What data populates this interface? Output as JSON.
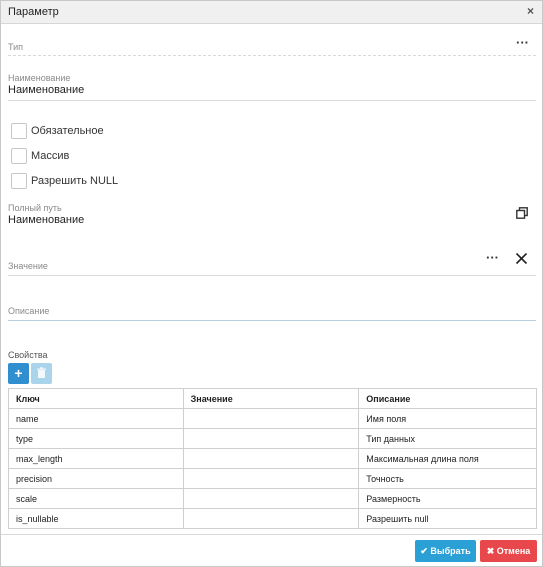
{
  "dialog": {
    "title": "Параметр",
    "close_glyph": "×"
  },
  "type_field": {
    "label": "Тип",
    "value": "",
    "action_glyph": "···"
  },
  "name_field": {
    "label": "Наименование",
    "value": "Наименование"
  },
  "checkboxes": [
    {
      "label": "Обязательное",
      "checked": false
    },
    {
      "label": "Массив",
      "checked": false
    },
    {
      "label": "Разрешить NULL",
      "checked": false
    }
  ],
  "full_path_field": {
    "label": "Полный путь",
    "value": "Наименование",
    "copy_icon": "copy-icon"
  },
  "value_field": {
    "label": "Значение",
    "value": "",
    "action_glyph": "···",
    "clear_icon": "close-icon"
  },
  "description_field": {
    "label": "Описание",
    "value": ""
  },
  "properties": {
    "label": "Свойства",
    "add_glyph": "+",
    "delete_icon": "trash-icon",
    "columns": [
      "Ключ",
      "Значение",
      "Описание"
    ],
    "rows": [
      {
        "key": "name",
        "value": "",
        "description": "Имя поля"
      },
      {
        "key": "type",
        "value": "",
        "description": "Тип данных"
      },
      {
        "key": "max_length",
        "value": "",
        "description": "Максимальная длина поля"
      },
      {
        "key": "precision",
        "value": "",
        "description": "Точность"
      },
      {
        "key": "scale",
        "value": "",
        "description": "Размерность"
      },
      {
        "key": "is_nullable",
        "value": "",
        "description": "Разрешить null"
      }
    ]
  },
  "footer": {
    "select_label": "Выбрать",
    "select_icon": "check-icon",
    "cancel_label": "Отмена",
    "cancel_icon": "x-icon"
  },
  "colors": {
    "primary": "#2aa0d6",
    "add_button": "#2f8fcf",
    "delete_button_disabled": "#a9d4ec",
    "danger": "#e8484b"
  }
}
